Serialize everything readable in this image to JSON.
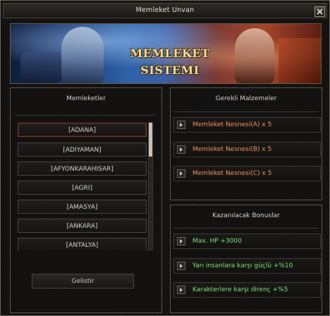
{
  "window": {
    "title": "Memleket Unvan"
  },
  "banner": {
    "title": "MEMLEKET SISTEMI"
  },
  "cities_panel": {
    "title": "Memleketler",
    "items": [
      "[ADANA]",
      "[ADIYAMAN]",
      "[AFYONKARAHISAR]",
      "[AGRI]",
      "[AMASYA]",
      "[ANKARA]",
      "[ANTALYA]"
    ],
    "selected": "[ADANA]",
    "develop_label": "Gelistir"
  },
  "materials_panel": {
    "title": "Gerekli Malzemeler",
    "items": [
      "Memleket Nesnesi(A) x 5",
      "Memleket Nesnesi(B) x 5",
      "Memleket Nesnesi(C) x 5"
    ]
  },
  "bonus_panel": {
    "title": "Kazanılacak Bonuslar",
    "items": [
      "Max. HP +3000",
      "Yarı insanlara karşı güçlü +%10",
      "Karakterlere karşı direnç +%5"
    ]
  },
  "colors": {
    "material_text": "#f2925a",
    "bonus_text": "#7fe07a",
    "selected_border": "#7a3b2f"
  },
  "icons": {
    "close": "close-x-icon",
    "row_arrow": "play-arrow-icon"
  }
}
